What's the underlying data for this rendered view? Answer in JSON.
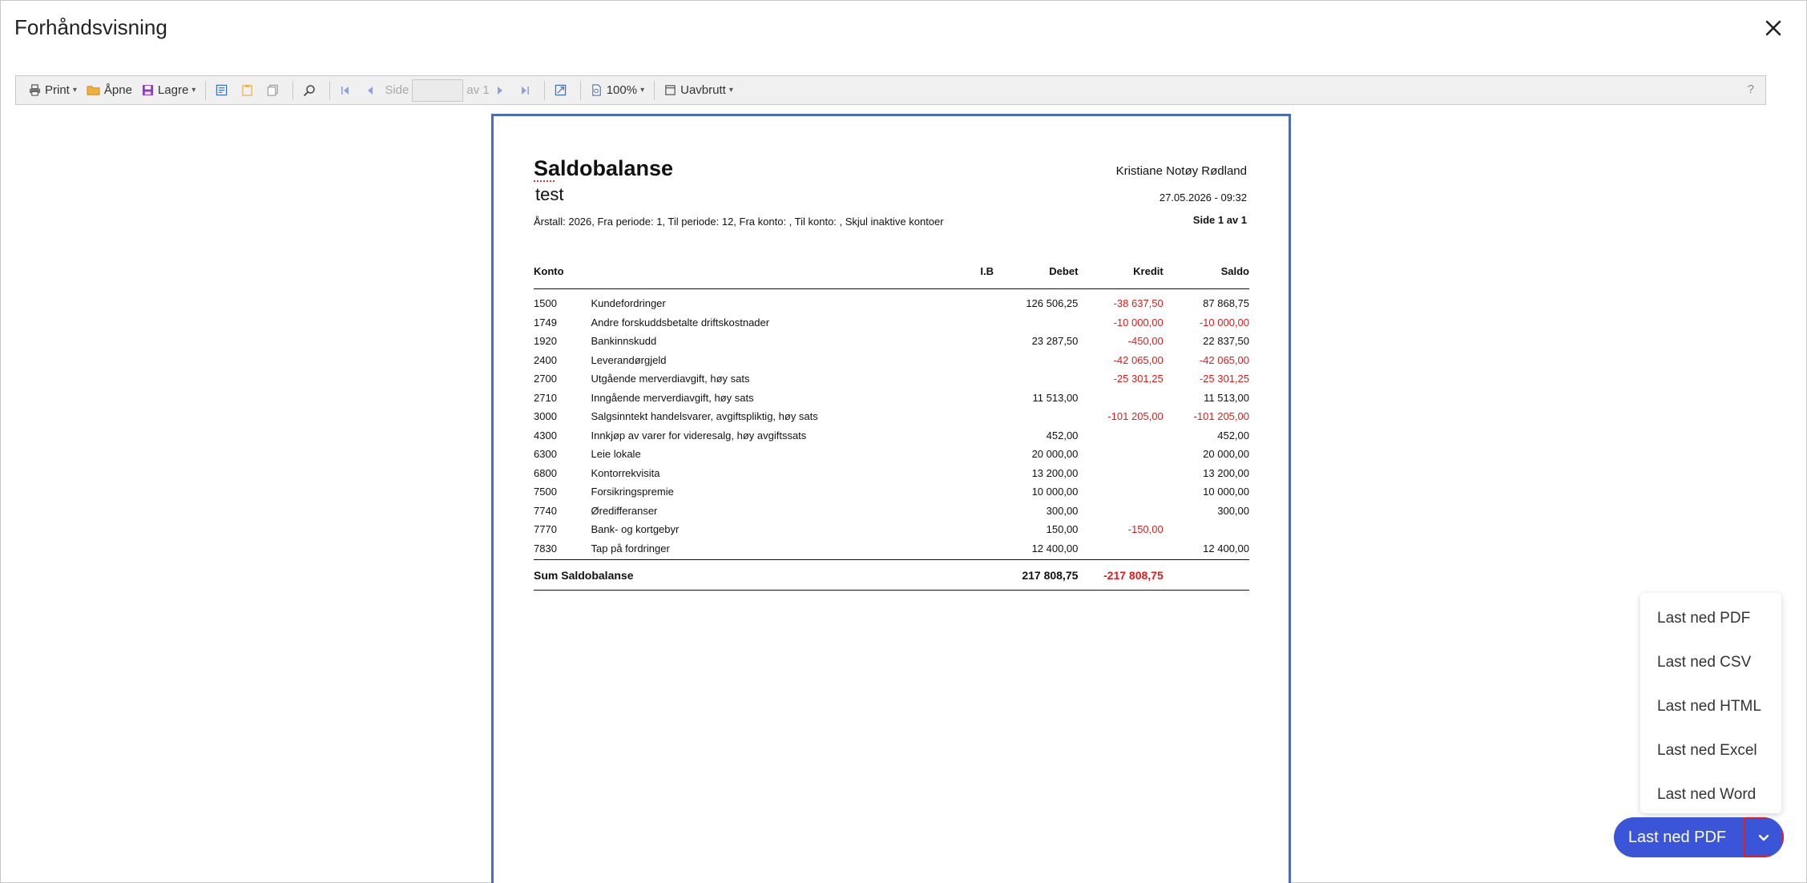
{
  "dialog": {
    "title": "Forhåndsvisning"
  },
  "toolbar": {
    "print": "Print",
    "open": "Åpne",
    "save": "Lagre",
    "page_label": "Side",
    "page_value": "",
    "page_of": "av 1",
    "zoom": "100%",
    "view_mode": "Uavbrutt",
    "help": "?"
  },
  "report": {
    "title": "Saldobalanse",
    "subtitle": "test",
    "params": "Årstall: 2026,  Fra periode: 1,  Til periode: 12,  Fra konto: ,  Til konto: ,  Skjul inaktive kontoer",
    "user": "Kristiane Notøy Rødland",
    "datetime": "27.05.2026 - 09:32",
    "page": "Side 1 av 1",
    "headers": {
      "konto": "Konto",
      "ib": "I.B",
      "debet": "Debet",
      "kredit": "Kredit",
      "saldo": "Saldo"
    },
    "rows": [
      {
        "konto": "1500",
        "name": "Kundefordringer",
        "ib": "",
        "debet": "126 506,25",
        "kredit": "-38 637,50",
        "saldo": "87 868,75"
      },
      {
        "konto": "1749",
        "name": "Andre forskuddsbetalte driftskostnader",
        "ib": "",
        "debet": "",
        "kredit": "-10 000,00",
        "saldo": "-10 000,00"
      },
      {
        "konto": "1920",
        "name": "Bankinnskudd",
        "ib": "",
        "debet": "23 287,50",
        "kredit": "-450,00",
        "saldo": "22 837,50"
      },
      {
        "konto": "2400",
        "name": "Leverandørgjeld",
        "ib": "",
        "debet": "",
        "kredit": "-42 065,00",
        "saldo": "-42 065,00"
      },
      {
        "konto": "2700",
        "name": "Utgående merverdiavgift, høy sats",
        "ib": "",
        "debet": "",
        "kredit": "-25 301,25",
        "saldo": "-25 301,25"
      },
      {
        "konto": "2710",
        "name": "Inngående merverdiavgift, høy sats",
        "ib": "",
        "debet": "11 513,00",
        "kredit": "",
        "saldo": "11 513,00"
      },
      {
        "konto": "3000",
        "name": "Salgsinntekt handelsvarer, avgiftspliktig, høy sats",
        "ib": "",
        "debet": "",
        "kredit": "-101 205,00",
        "saldo": "-101 205,00"
      },
      {
        "konto": "4300",
        "name": "Innkjøp av varer for videresalg, høy avgiftssats",
        "ib": "",
        "debet": "452,00",
        "kredit": "",
        "saldo": "452,00"
      },
      {
        "konto": "6300",
        "name": "Leie lokale",
        "ib": "",
        "debet": "20 000,00",
        "kredit": "",
        "saldo": "20 000,00"
      },
      {
        "konto": "6800",
        "name": "Kontorrekvisita",
        "ib": "",
        "debet": "13 200,00",
        "kredit": "",
        "saldo": "13 200,00"
      },
      {
        "konto": "7500",
        "name": "Forsikringspremie",
        "ib": "",
        "debet": "10 000,00",
        "kredit": "",
        "saldo": "10 000,00"
      },
      {
        "konto": "7740",
        "name": "Øredifferanser",
        "ib": "",
        "debet": "300,00",
        "kredit": "",
        "saldo": "300,00"
      },
      {
        "konto": "7770",
        "name": "Bank- og kortgebyr",
        "ib": "",
        "debet": "150,00",
        "kredit": "-150,00",
        "saldo": ""
      },
      {
        "konto": "7830",
        "name": "Tap på fordringer",
        "ib": "",
        "debet": "12 400,00",
        "kredit": "",
        "saldo": "12 400,00"
      }
    ],
    "sum": {
      "label": "Sum Saldobalanse",
      "debet": "217 808,75",
      "kredit": "-217 808,75"
    }
  },
  "download_menu": {
    "items": [
      "Last ned PDF",
      "Last ned CSV",
      "Last ned HTML",
      "Last ned Excel",
      "Last ned Word"
    ]
  },
  "download_button": {
    "label": "Last ned PDF"
  },
  "colors": {
    "accent": "#3a55d8",
    "negative": "#e01b1b",
    "page_border": "#4a6bbf"
  }
}
